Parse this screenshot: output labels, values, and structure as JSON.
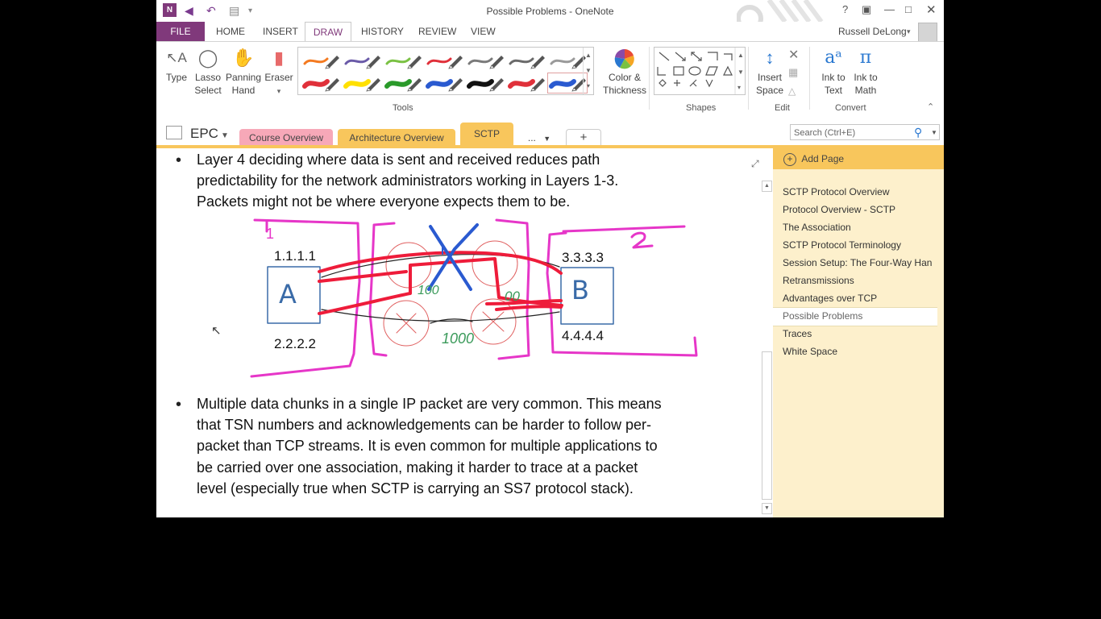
{
  "window": {
    "title": "Possible Problems - OneNote",
    "help": "?",
    "user": "Russell DeLong"
  },
  "ribbon_tabs": [
    "FILE",
    "HOME",
    "INSERT",
    "DRAW",
    "HISTORY",
    "REVIEW",
    "VIEW"
  ],
  "tools": {
    "type": "Type",
    "lasso": [
      "Lasso",
      "Select"
    ],
    "panning": [
      "Panning",
      "Hand"
    ],
    "eraser": "Eraser",
    "color": [
      "Color &",
      "Thickness"
    ],
    "insert_space": [
      "Insert",
      "Space"
    ],
    "ink_text": [
      "Ink to",
      "Text"
    ],
    "ink_math": [
      "Ink to",
      "Math"
    ],
    "group_tools": "Tools",
    "group_shapes": "Shapes",
    "group_edit": "Edit",
    "group_convert": "Convert"
  },
  "pen_colors": [
    "#f47a20",
    "#6a5aa8",
    "#7ac143",
    "#e0303a",
    "#7a7a7a",
    "#6a6a6a",
    "#9a9a9a",
    "#e0303a",
    "#ffe000",
    "#2a9a2a",
    "#2a5ad0",
    "#111111",
    "#e0303a",
    "#2a5ad0"
  ],
  "notebook": {
    "name": "EPC",
    "sections": [
      {
        "label": "Course Overview",
        "color": "#f7a8b8"
      },
      {
        "label": "Architecture Overview",
        "color": "#f8c65c"
      },
      {
        "label": "SCTP",
        "color": "#f8c65c"
      }
    ],
    "more": "...",
    "add": "+",
    "search_placeholder": "Search (Ctrl+E)"
  },
  "content": {
    "para1": [
      "Layer 4 deciding where data is sent and received reduces path",
      "predictability for the network administrators working in Layers 1-3.",
      "Packets might not be where everyone expects them to be."
    ],
    "diagram": {
      "ip_tl": "1.1.1.1",
      "ip_bl": "2.2.2.2",
      "ip_tr": "3.3.3.3",
      "ip_br": "4.4.4.4",
      "node_a": "A",
      "node_b": "B",
      "mark_1": "1",
      "mark_2": "2",
      "cost_left": "100",
      "cost_right": "00",
      "cost_bottom": "1000"
    },
    "para2": [
      "Multiple data chunks in a single IP packet are very common. This means",
      "that TSN numbers and acknowledgements can be harder to follow per-",
      "packet than TCP streams. It is even common for multiple applications to",
      "be carried over one association, making it harder to trace at a packet",
      "level (especially true when SCTP is carrying an SS7 protocol stack)."
    ]
  },
  "pages": {
    "add_page": "Add Page",
    "items": [
      "SCTP Protocol Overview",
      "Protocol Overview - SCTP",
      "The Association",
      "SCTP Protocol Terminology",
      "Session Setup: The Four-Way Han",
      "Retransmissions",
      "Advantages over TCP",
      "Possible Problems",
      "Traces",
      "White Space"
    ],
    "selected_index": 7
  }
}
